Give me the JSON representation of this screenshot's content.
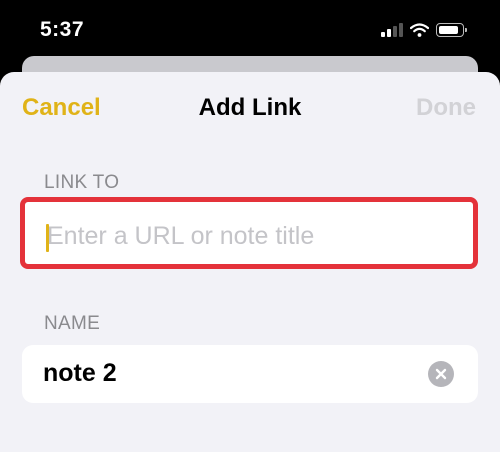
{
  "status_bar": {
    "time": "5:37",
    "icons": [
      "signal-icon",
      "wifi-icon",
      "battery-icon"
    ]
  },
  "nav": {
    "cancel_label": "Cancel",
    "title": "Add Link",
    "done_label": "Done"
  },
  "link_to": {
    "label": "LINK TO",
    "value": "",
    "placeholder": "Enter a URL or note title"
  },
  "name": {
    "label": "NAME",
    "value": "note 2",
    "clear_icon": "clear-icon"
  },
  "colors": {
    "accent": "#e0b318",
    "highlight": "#e4323a",
    "sheet_bg": "#f2f2f7",
    "disabled": "#d2d2d6",
    "label": "#8a8a8e"
  }
}
